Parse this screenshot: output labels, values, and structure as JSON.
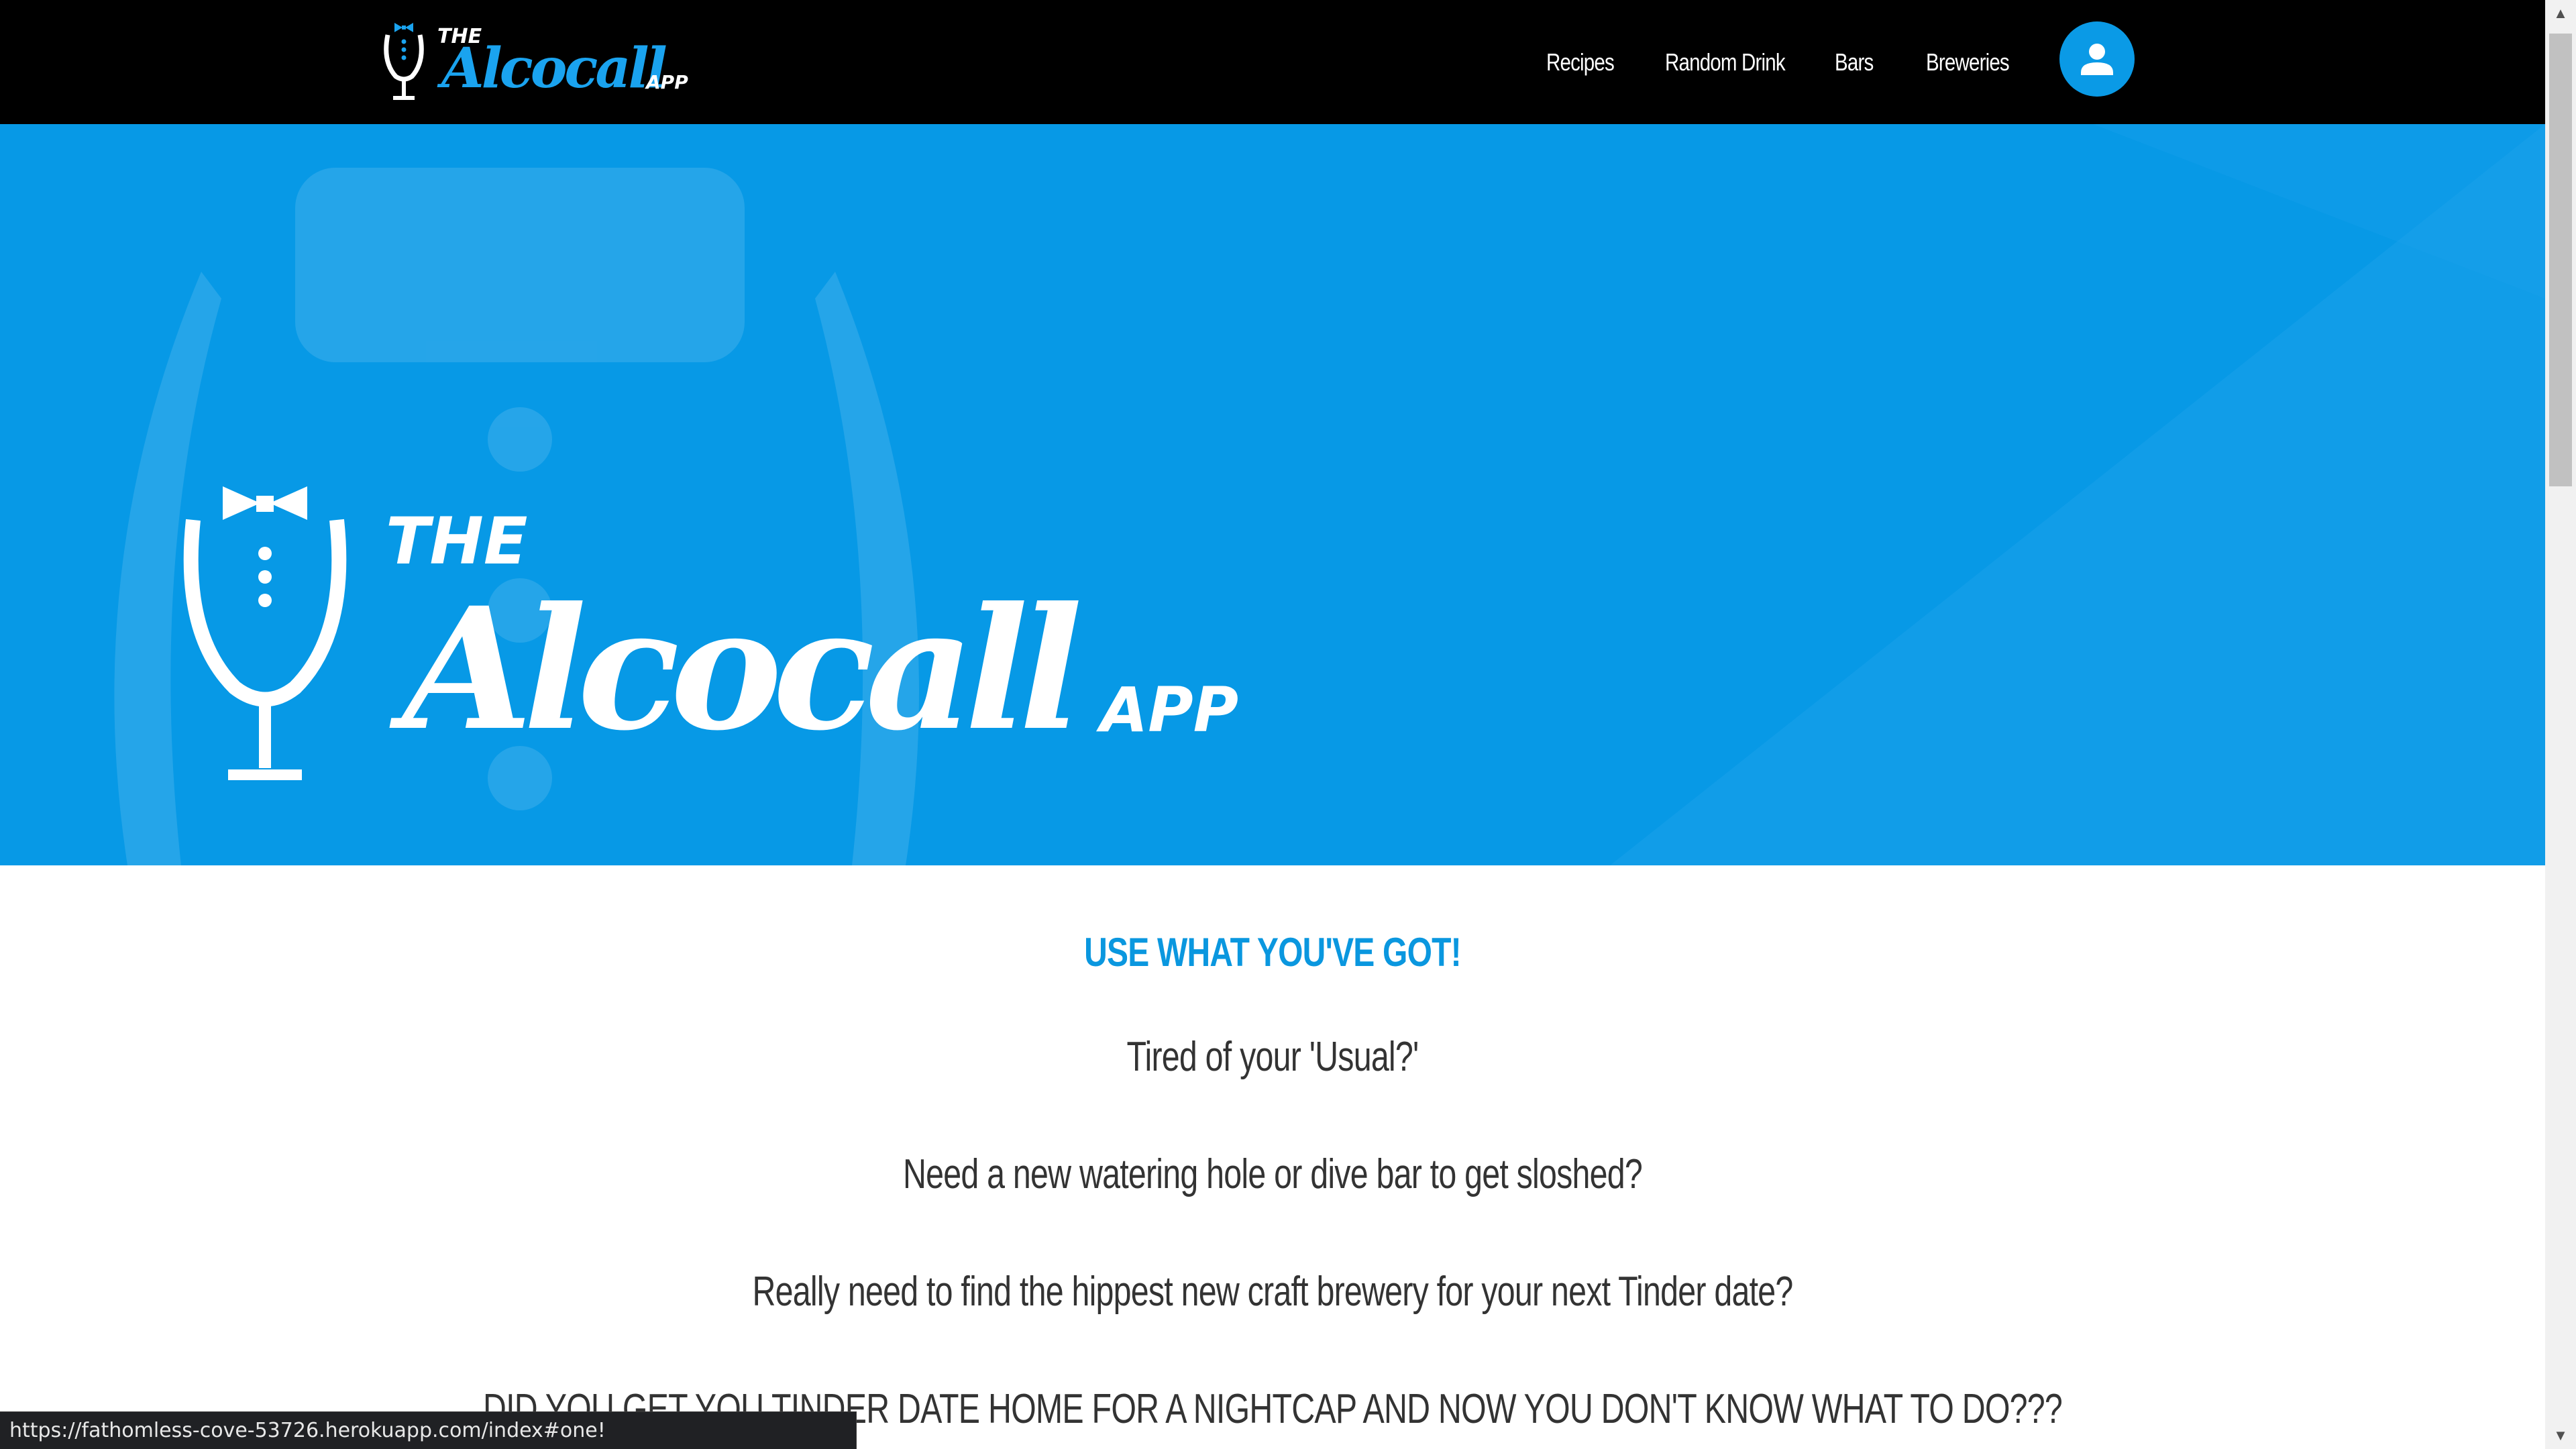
{
  "app": {
    "logo_text": {
      "the": "THE",
      "name": "Alcocall",
      "suffix": "APP"
    }
  },
  "nav": {
    "links": [
      {
        "label": "Recipes"
      },
      {
        "label": "Random Drink"
      },
      {
        "label": "Bars"
      },
      {
        "label": "Breweries"
      }
    ],
    "profile_icon": "person-icon"
  },
  "content": {
    "headline": "USE WHAT YOU'VE GOT!",
    "lines": [
      "Tired of your 'Usual?'",
      "Need a new watering hole or dive bar to get sloshed?",
      "Really need to find the hippest new craft brewery for your next Tinder date?",
      "DID YOU GET YOU TINDER DATE HOME FOR A NIGHTCAP AND NOW YOU DON'T KNOW WHAT TO DO???"
    ]
  },
  "status_bar": {
    "url": "https://fathomless-cove-53726.herokuapp.com/index#one!"
  },
  "colors": {
    "nav_bg": "#000000",
    "accent": "#0799e6",
    "headline": "#0a97df",
    "body_text": "#333333"
  }
}
